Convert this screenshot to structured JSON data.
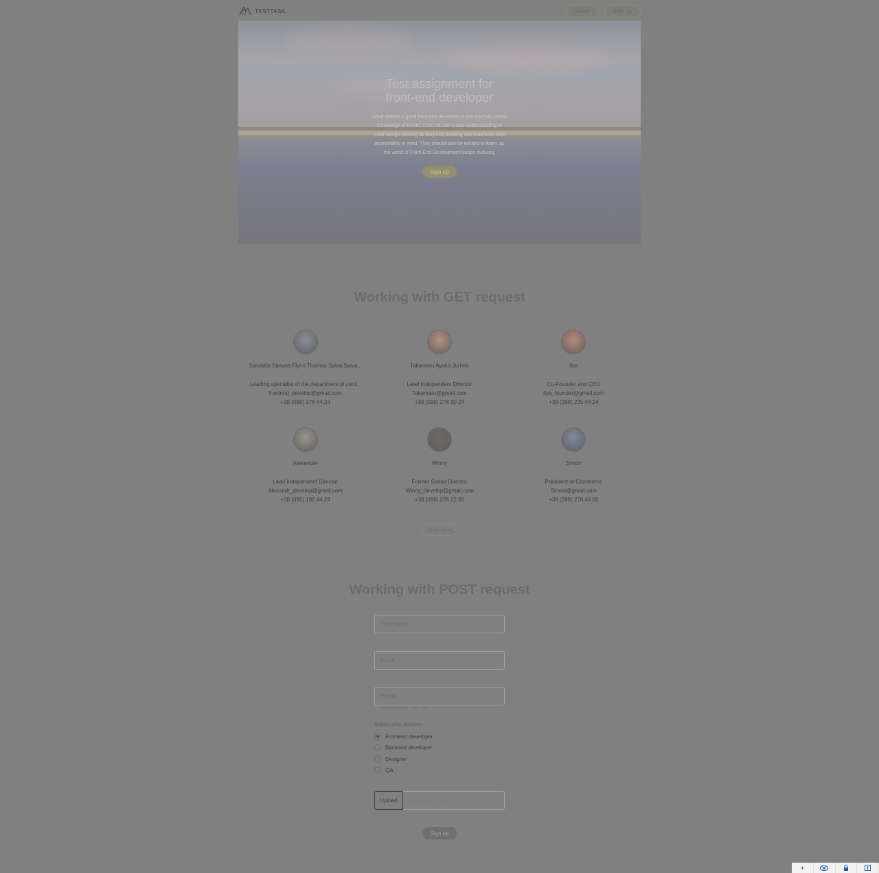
{
  "header": {
    "logo_text": "TESTTASK",
    "nav": [
      "Users",
      "Sign up"
    ]
  },
  "hero": {
    "title": "Test assignment for front-end developer",
    "text": "What defines a good front-end developer is one that has skilled knowledge of HTML, CSS, JS with a vast understanding of User design thinking as they'll be building web interfaces with accessibility in mind. They should also be excited to learn, as the world of Front-End Development keeps evolving.",
    "button": "Sign up"
  },
  "get_section": {
    "title": "Working with GET request",
    "users": [
      {
        "name": "Salvador Stewart Flynn Thomas Salva Salva...",
        "position": "Leading specialist of the department of cent...",
        "email": "frontend_develop@gmail.com",
        "phone": "+38 (098) 278 44 24",
        "avatar_color": "#8a8f97"
      },
      {
        "name": "Takamaru Ayako Jurrien",
        "position": "Lead Independent Director",
        "email": "Takamaru@gmail.com",
        "phone": "+38 (098) 278 90 24",
        "avatar_color": "#b8917f"
      },
      {
        "name": "Ilya",
        "position": "Co-Founder and CEO",
        "email": "Ilya_founder@gmail.com",
        "phone": "+38 (098) 235 44 24",
        "avatar_color": "#b88a7a"
      },
      {
        "name": "Alexandre",
        "position": "Lead Independent Director",
        "email": "Alexandr_develop@gmail.com",
        "phone": "+38 (098) 198 44 24",
        "avatar_color": "#9a9690"
      },
      {
        "name": "Winny",
        "position": "Former Senior Director",
        "email": "Winny_develop@gmail.com",
        "phone": "+38 (098) 278 22 88",
        "avatar_color": "#6e6a60"
      },
      {
        "name": "Simon",
        "position": "President of Commerce",
        "email": "Simon@gmail.com",
        "phone": "+38 (098) 278 44 00",
        "avatar_color": "#7f8aa0"
      }
    ],
    "show_more": "Show more"
  },
  "post_section": {
    "title": "Working with POST request",
    "name_placeholder": "Your name",
    "email_placeholder": "Email",
    "phone_placeholder": "Phone",
    "phone_helper": "+38 (XXX) XXX - XX - XX",
    "radio_title": "Select your position",
    "positions": [
      "Frontend developer",
      "Backend developer",
      "Designer",
      "QA"
    ],
    "selected_position": "Frontend developer",
    "upload_button": "Upload",
    "upload_placeholder": "Upload your photo",
    "submit": "Sign up"
  },
  "toolbar": {
    "items": [
      "+",
      "eye-icon",
      "lock-icon",
      "info-icon"
    ]
  }
}
